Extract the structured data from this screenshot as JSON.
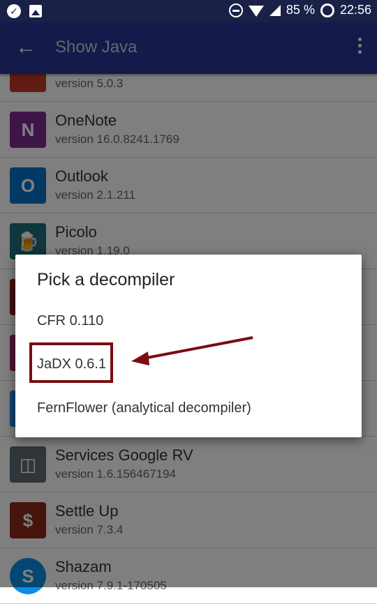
{
  "status_bar": {
    "icons": [
      "check-circle-icon",
      "image-icon",
      "dnd-icon",
      "wifi-icon",
      "signal-icon",
      "battery-ring-icon"
    ],
    "battery": "85 %",
    "time": "22:56"
  },
  "app_bar": {
    "title": "Show Java",
    "back_icon": "arrow-back-icon",
    "menu_icon": "more-vert-icon"
  },
  "apps": [
    {
      "name": "",
      "version": "version 5.0.3",
      "icon": "app-icon",
      "color": "#c0392b"
    },
    {
      "name": "OneNote",
      "version": "version 16.0.8241.1769",
      "icon": "onenote-icon",
      "color": "#7b2d8e"
    },
    {
      "name": "Outlook",
      "version": "version 2.1.211",
      "icon": "outlook-icon",
      "color": "#0072c6"
    },
    {
      "name": "Picolo",
      "version": "version 1.19.0",
      "icon": "picolo-icon",
      "color": "#1e6f7a"
    },
    {
      "name": "Services Google RV",
      "version": "version 1.6.156467194",
      "icon": "cardboard-icon",
      "color": "#5f6a70"
    },
    {
      "name": "Settle Up",
      "version": "version 7.3.4",
      "icon": "settleup-icon",
      "color": "#8b2a1a"
    },
    {
      "name": "Shazam",
      "version": "version 7.9.1-170505",
      "icon": "shazam-icon",
      "color": "#0a8fe5"
    }
  ],
  "dialog": {
    "title": "Pick a decompiler",
    "options": [
      "CFR 0.110",
      "JaDX 0.6.1",
      "FernFlower (analytical decompiler)"
    ]
  },
  "annotation": {
    "color": "#7a0d12",
    "highlighted_option": "JaDX 0.6.1"
  }
}
